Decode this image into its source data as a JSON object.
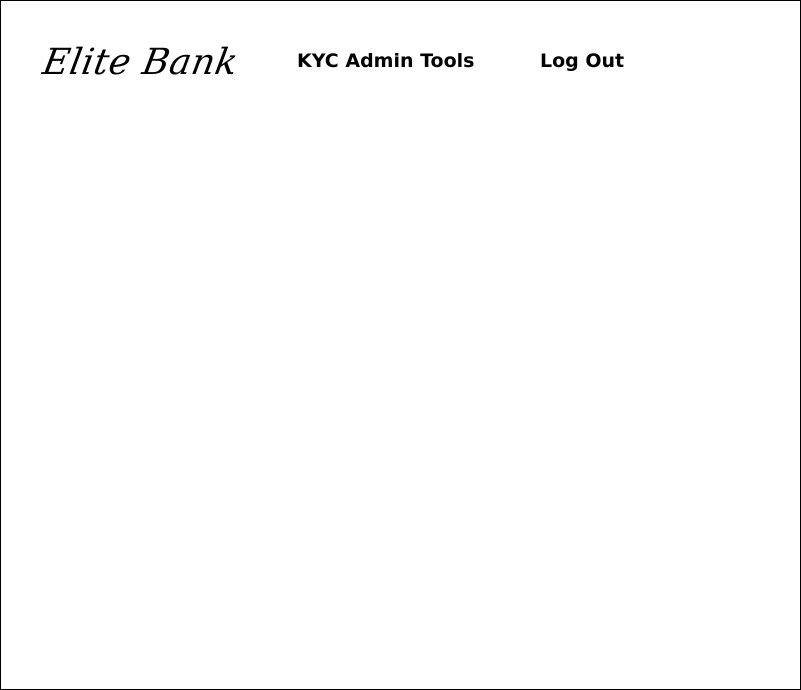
{
  "header": {
    "brand": "Elite Bank",
    "nav": {
      "kyc_admin_tools": "KYC Admin Tools",
      "log_out": "Log Out"
    }
  },
  "colors": {
    "background": "#ffffff",
    "text": "#000000",
    "border": "#000000"
  }
}
